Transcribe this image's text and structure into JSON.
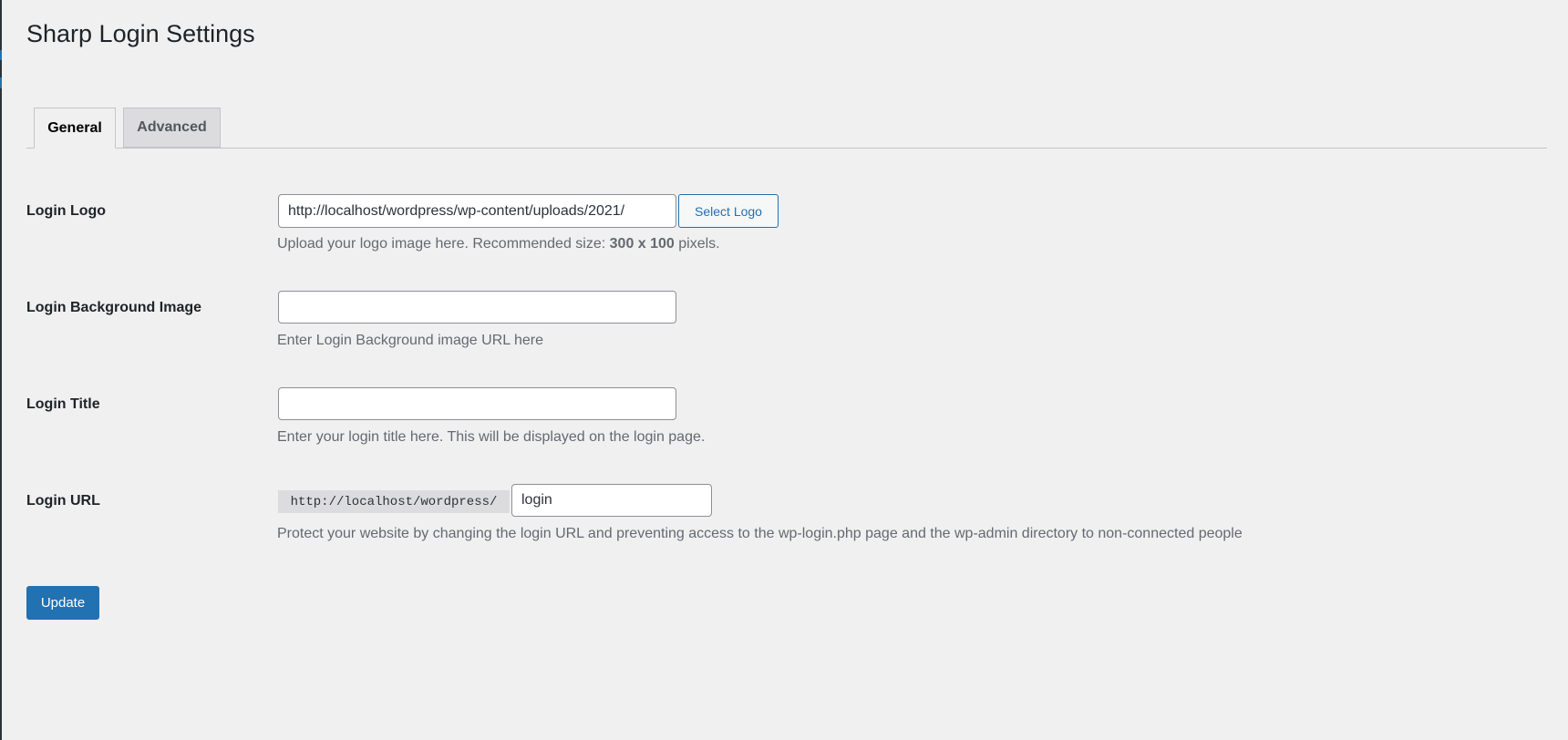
{
  "page_title": "Sharp Login Settings",
  "tabs": [
    {
      "label": "General",
      "active": true
    },
    {
      "label": "Advanced",
      "active": false
    }
  ],
  "fields": {
    "logo": {
      "label": "Login Logo",
      "value": "http://localhost/wordpress/wp-content/uploads/2021/",
      "button": "Select Logo",
      "desc_prefix": "Upload your logo image here. Recommended size: ",
      "desc_bold": "300 x 100",
      "desc_suffix": " pixels."
    },
    "background": {
      "label": "Login Background Image",
      "value": "",
      "desc": "Enter Login Background image URL here"
    },
    "title": {
      "label": "Login Title",
      "value": "",
      "desc": "Enter your login title here. This will be displayed on the login page."
    },
    "url": {
      "label": "Login URL",
      "prefix": "http://localhost/wordpress/",
      "value": "login",
      "desc": "Protect your website by changing the login URL and preventing access to the wp-login.php page and the wp-admin directory to non-connected people"
    }
  },
  "update_label": "Update",
  "colors": {
    "accent": "#2271b1",
    "background": "#f0f0f1"
  }
}
